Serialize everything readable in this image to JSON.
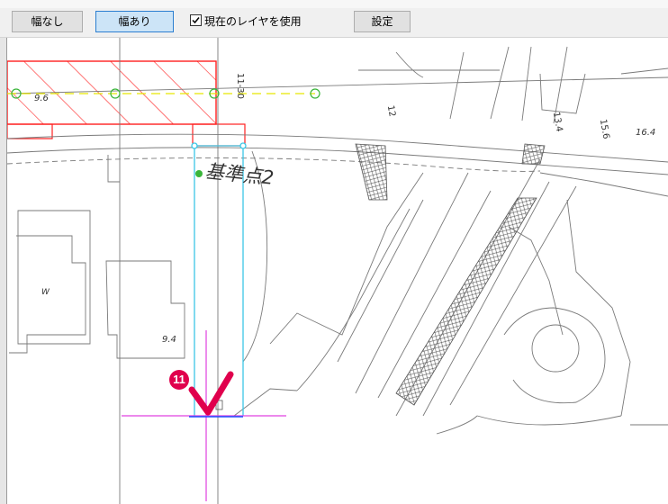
{
  "toolbar": {
    "width_none_label": "幅なし",
    "width_on_label": "幅あり",
    "use_current_layer_label": "現在のレイヤを使用",
    "use_current_layer_checked": true,
    "settings_label": "設定"
  },
  "drawing": {
    "benchmark_label": "基準点2",
    "step_number": "11",
    "small_labels": {
      "elev_a": "9.6",
      "elev_b": "9.4",
      "num_a": "11-30",
      "num_b": "12",
      "num_c": "13.4",
      "num_d": "15.6",
      "num_e": "16.4",
      "mark_w": "W"
    }
  },
  "colors": {
    "hatch_red": "#ff2020",
    "route_yellow": "#e6e600",
    "node_green": "#3ab53a",
    "road_cyan": "#3cc7e6",
    "cursor_magenta": "#e040e0",
    "guide_blue": "#2050ff",
    "check_mark": "#e0004d"
  }
}
